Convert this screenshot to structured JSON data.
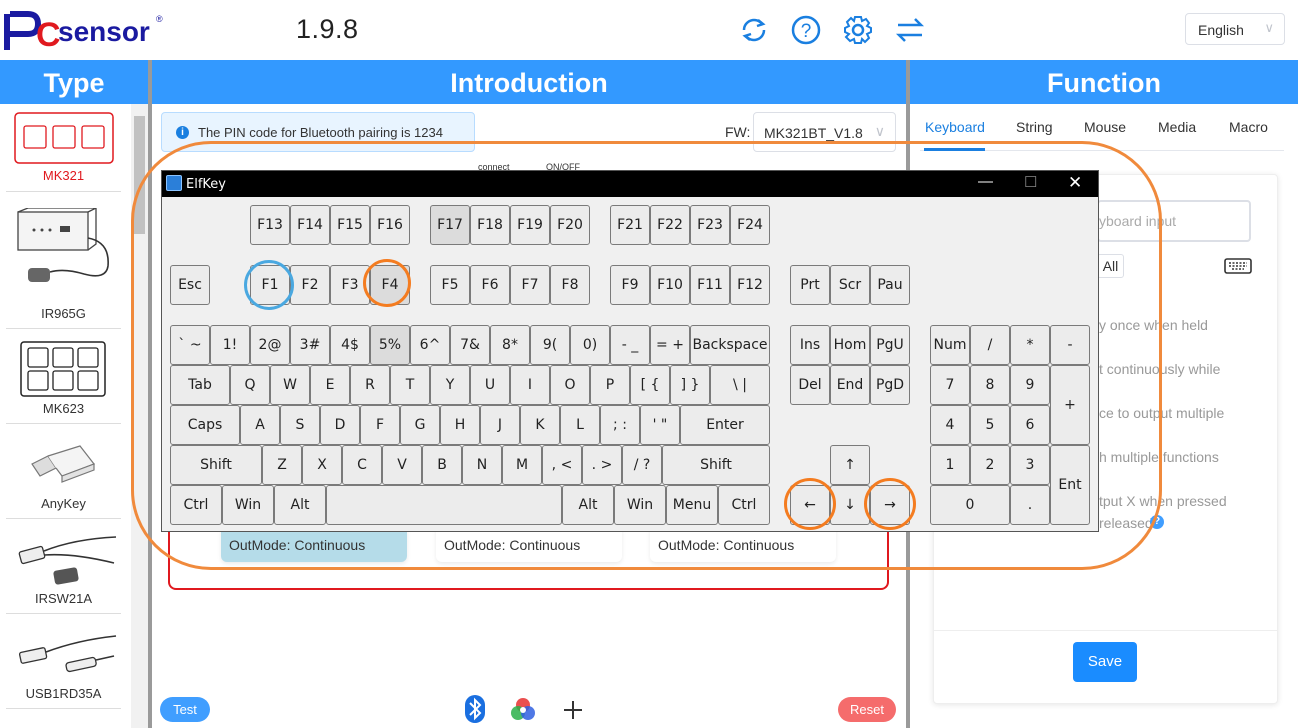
{
  "header": {
    "brand": "PCsensor",
    "version": "1.9.8",
    "icons": [
      "refresh-icon",
      "help-icon",
      "gear-icon",
      "switch-icon"
    ],
    "language": "English"
  },
  "columns": {
    "type": "Type",
    "introduction": "Introduction",
    "function": "Function"
  },
  "types": [
    {
      "label": "MK321",
      "selected": true
    },
    {
      "label": "IR965G"
    },
    {
      "label": "MK623"
    },
    {
      "label": "AnyKey"
    },
    {
      "label": "IRSW21A"
    },
    {
      "label": "USB1RD35A"
    }
  ],
  "intro": {
    "pin_note": "The PIN code for Bluetooth pairing is 1234",
    "fw_label": "FW:",
    "fw_value": "MK321BT_V1.8",
    "connect_label": "connect",
    "onoff_label": "ON/OFF",
    "outmodes": [
      "OutMode:  Continuous",
      "OutMode:  Continuous",
      "OutMode:  Continuous"
    ],
    "test_button": "Test",
    "reset_button": "Reset",
    "bottom_icons": [
      "bluetooth-icon",
      "rgb-icon",
      "plus-icon"
    ]
  },
  "function": {
    "tabs": [
      "Keyboard",
      "String",
      "Mouse",
      "Media",
      "Macro"
    ],
    "active_tab": "Keyboard",
    "input_placeholder": "yboard input",
    "all_label": "All",
    "options": [
      "y once when held",
      "t continuously while",
      "ce to output multiple",
      "h multiple functions",
      "tput X when pressed",
      "released"
    ],
    "save_button": "Save"
  },
  "elfkey": {
    "title": "ElfKey",
    "fkeys_top": [
      "F13",
      "F14",
      "F15",
      "F16",
      "F17",
      "F18",
      "F19",
      "F20",
      "F21",
      "F22",
      "F23",
      "F24"
    ],
    "fkeys": [
      "Esc",
      "F1",
      "F2",
      "F3",
      "F4",
      "F5",
      "F6",
      "F7",
      "F8",
      "F9",
      "F10",
      "F11",
      "F12",
      "Prt",
      "Scr",
      "Pau"
    ],
    "row1": [
      "` ~",
      "1!",
      "2@",
      "3#",
      "4$",
      "5%",
      "6^",
      "7&",
      "8*",
      "9(",
      "0)",
      "- _",
      "= +",
      "Backspace"
    ],
    "row2": [
      "Tab",
      "Q",
      "W",
      "E",
      "R",
      "T",
      "Y",
      "U",
      "I",
      "O",
      "P",
      "[ {",
      "] }",
      "\\ |"
    ],
    "row3": [
      "Caps",
      "A",
      "S",
      "D",
      "F",
      "G",
      "H",
      "J",
      "K",
      "L",
      "; :",
      "' \"",
      "Enter"
    ],
    "row4": [
      "Shift",
      "Z",
      "X",
      "C",
      "V",
      "B",
      "N",
      "M",
      ", <",
      ". >",
      "/ ?",
      "Shift"
    ],
    "row5": [
      "Ctrl",
      "Win",
      "Alt",
      "",
      "Alt",
      "Win",
      "Menu",
      "Ctrl"
    ],
    "nav": [
      "Ins",
      "Hom",
      "PgU",
      "Del",
      "End",
      "PgD"
    ],
    "arrows": [
      "↑",
      "←",
      "↓",
      "→"
    ],
    "numpad": [
      "Num",
      "/",
      "*",
      "-",
      "7",
      "8",
      "9",
      "+",
      "4",
      "5",
      "6",
      "1",
      "2",
      "3",
      "Ent",
      "0",
      "."
    ]
  },
  "colors": {
    "accent": "#3399ff",
    "highlight_ring": "#f47c20",
    "blue_ring": "#4aa8e0",
    "danger": "#f56c6c"
  }
}
